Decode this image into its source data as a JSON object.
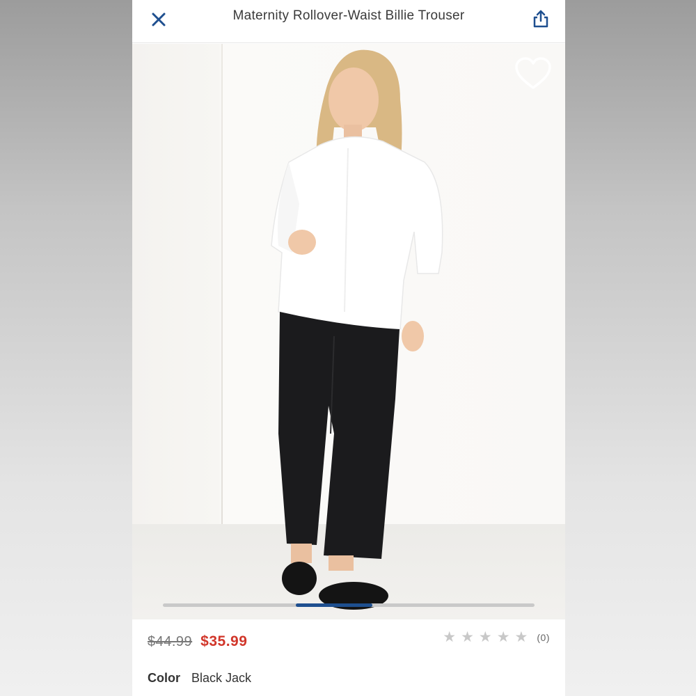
{
  "header": {
    "title": "Maternity Rollover-Waist Billie Trouser",
    "close_icon": "close-icon",
    "share_icon": "share-icon"
  },
  "product_image": {
    "favorite_icon": "heart-outline-icon",
    "carousel_progress": 0.45
  },
  "pricing": {
    "original_price": "$44.99",
    "sale_price": "$35.99"
  },
  "rating": {
    "stars": 0,
    "max_stars": 5,
    "review_count": "(0)"
  },
  "color": {
    "label": "Color",
    "value": "Black Jack"
  },
  "colors": {
    "accent": "#1e4f8f",
    "sale": "#d1362a"
  }
}
